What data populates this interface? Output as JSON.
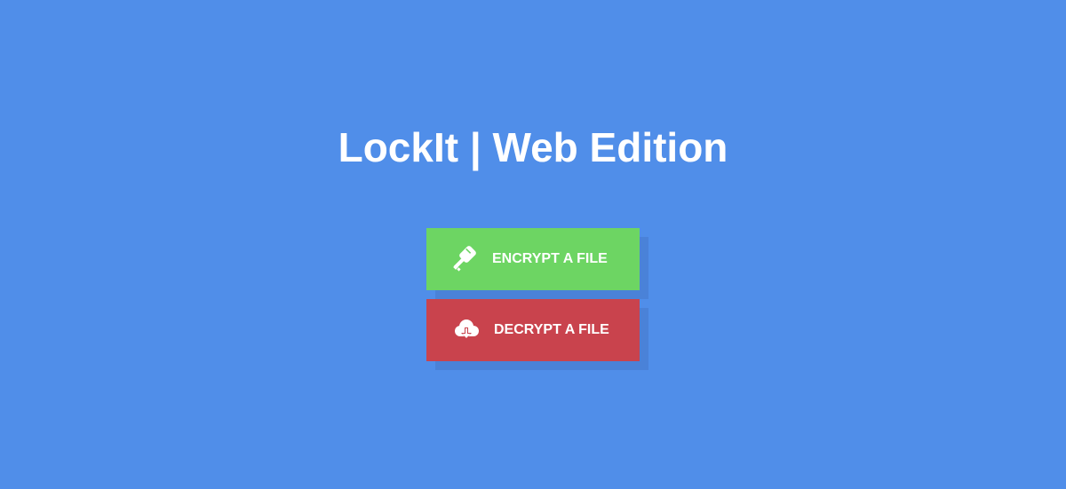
{
  "page": {
    "title": "LockIt | Web Edition"
  },
  "actions": {
    "encrypt": {
      "label": "ENCRYPT A FILE",
      "icon": "key-icon",
      "color": "#6dd563"
    },
    "decrypt": {
      "label": "DECRYPT A FILE",
      "icon": "cloud-download-icon",
      "color": "#c9434d"
    }
  },
  "colors": {
    "background": "#508ee9",
    "shadow": "#4a82d8",
    "text": "#ffffff"
  }
}
